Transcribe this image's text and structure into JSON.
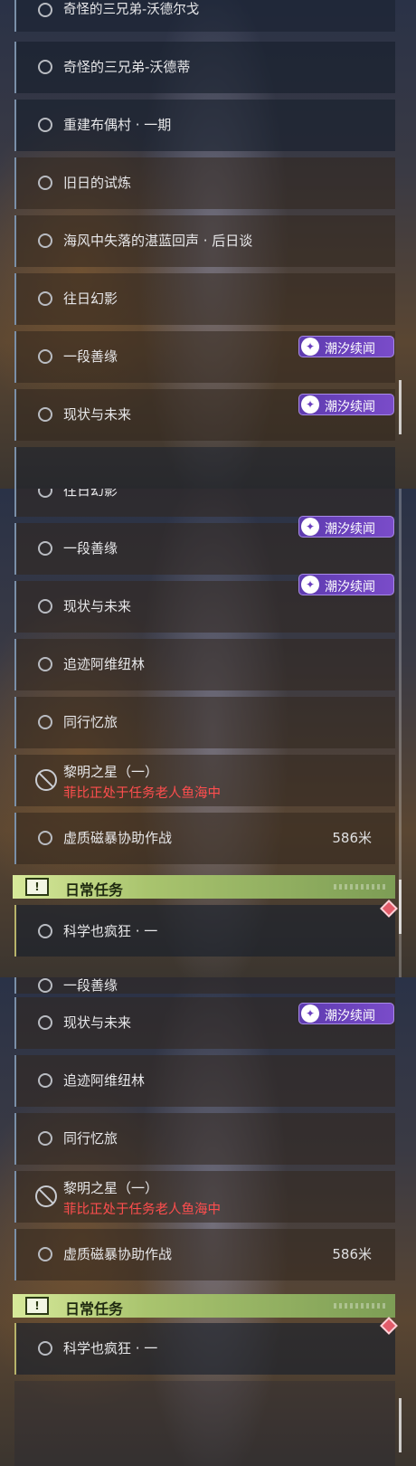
{
  "panel1": {
    "rows": [
      {
        "title": "奇怪的三兄弟-沃德尔戈"
      },
      {
        "title": "奇怪的三兄弟-沃德蒂"
      },
      {
        "title": "重建布偶村 · 一期"
      },
      {
        "title": "旧日的试炼"
      },
      {
        "title": "海风中失落的湛蓝回声 · 后日谈"
      },
      {
        "title": "往日幻影"
      },
      {
        "title": "一段善缘",
        "tag": "潮汐续闻"
      },
      {
        "title": "现状与未来",
        "tag": "潮汐续闻"
      }
    ]
  },
  "panel2": {
    "rows": [
      {
        "title": "往日幻影"
      },
      {
        "title": "一段善缘",
        "tag": "潮汐续闻"
      },
      {
        "title": "现状与未来",
        "tag": "潮汐续闻"
      },
      {
        "title": "追迹阿维纽林"
      },
      {
        "title": "同行忆旅"
      },
      {
        "title": "黎明之星（一）",
        "subtitle": "菲比正处于任务老人鱼海中"
      },
      {
        "title": "虚质磁暴协助作战",
        "distance": "586米"
      }
    ],
    "section": {
      "label": "日常任务",
      "icon": "!"
    },
    "partial_row": {
      "title": "科学也疯狂 · 一"
    }
  },
  "panel3": {
    "rows": [
      {
        "title": "一段善缘"
      },
      {
        "title": "现状与未来",
        "tag": "潮汐续闻"
      },
      {
        "title": "追迹阿维纽林"
      },
      {
        "title": "同行忆旅"
      },
      {
        "title": "黎明之星（一）",
        "subtitle": "菲比正处于任务老人鱼海中"
      },
      {
        "title": "虚质磁暴协助作战",
        "distance": "586米"
      }
    ],
    "section": {
      "label": "日常任务",
      "icon": "!"
    },
    "daily_rows": [
      {
        "title": "科学也疯狂 · 一"
      }
    ]
  },
  "colors": {
    "tag_purple": "#6a3fc0",
    "section_green": "#a9c46e",
    "warning_red": "#ff4e4e",
    "marker_red": "#e25c6a"
  },
  "icons": {
    "quest_status": "ring-icon",
    "blocked": "blocked-icon",
    "tag": "tidal-tales-icon",
    "section": "alert-icon",
    "marker": "diamond-marker-icon"
  }
}
